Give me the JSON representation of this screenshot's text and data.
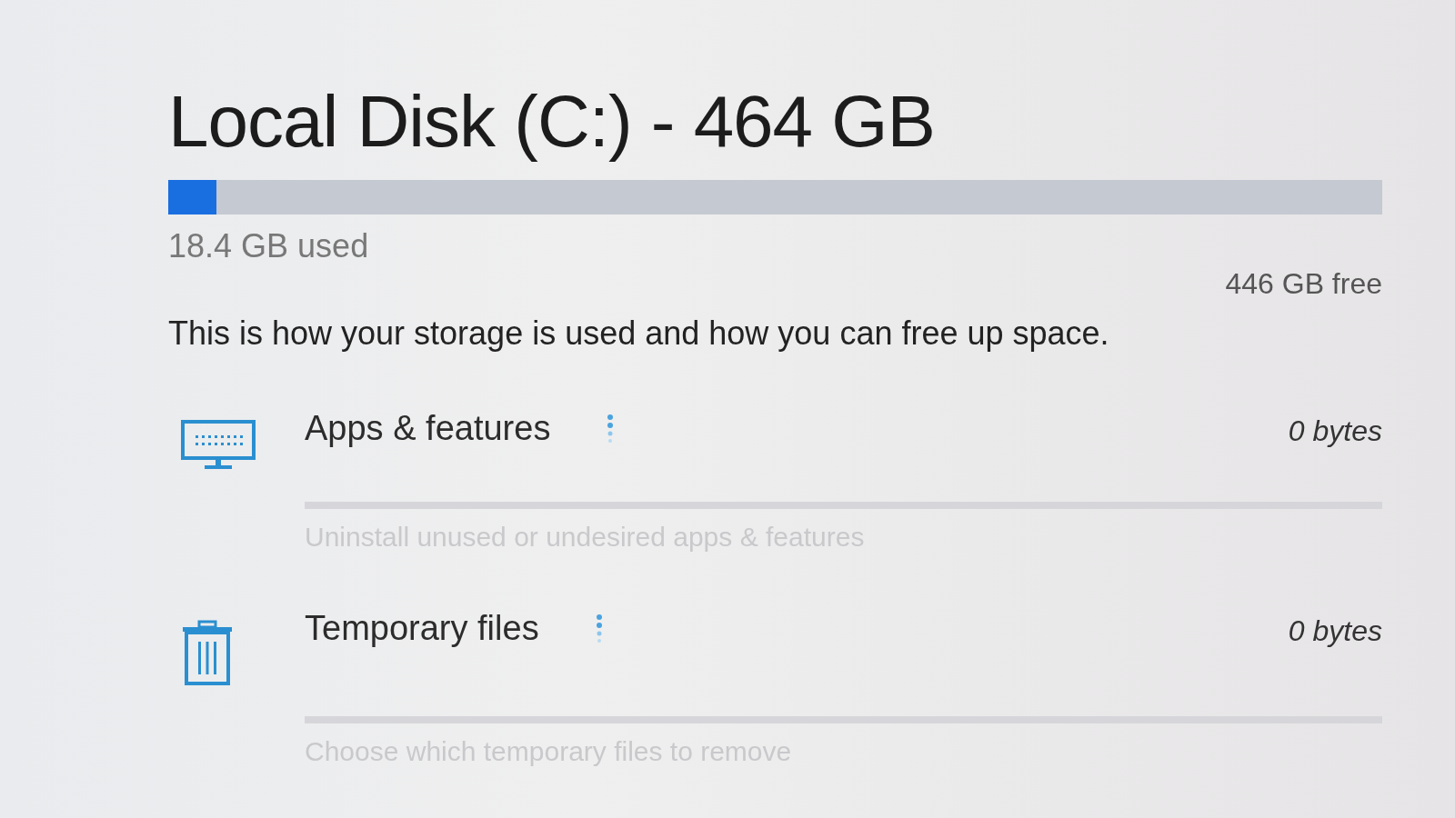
{
  "drive": {
    "title": "Local Disk (C:) - 464 GB",
    "level": 0.04,
    "used": "18.4 GB used",
    "free": "446 GB free"
  },
  "description": "This is how your storage is used and how you can free up space.",
  "categories": [
    {
      "kind": "apps",
      "label": "Apps & features",
      "loading": true,
      "size": "0 bytes",
      "hint": "Uninstall unused or undesired apps & features"
    },
    {
      "kind": "temp",
      "label": "Temporary files",
      "loading": true,
      "size": "0 bytes",
      "hint": "Choose which temporary files to remove"
    }
  ]
}
